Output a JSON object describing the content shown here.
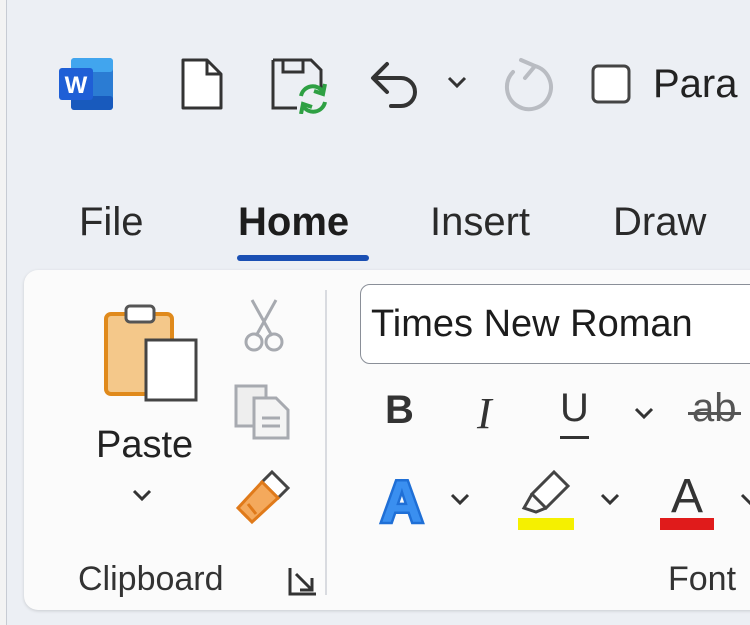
{
  "qat": {
    "document_title_partial": "Para K",
    "icons": [
      "word-logo-icon",
      "new-document-icon",
      "save-sync-icon",
      "undo-icon",
      "chevron-down-icon",
      "redo-icon",
      "checkbox-icon"
    ]
  },
  "tabs": [
    {
      "label": "File"
    },
    {
      "label": "Home",
      "active": true
    },
    {
      "label": "Insert"
    },
    {
      "label": "Draw"
    }
  ],
  "clipboard": {
    "paste_label": "Paste",
    "group_label": "Clipboard"
  },
  "font": {
    "font_name": "Times New Roman",
    "bold": "B",
    "italic": "I",
    "underline": "U",
    "strikethrough": "ab",
    "text_effect_letter": "A",
    "font_color_letter": "A",
    "group_label": "Font",
    "highlight_color": "#f5f000",
    "font_color": "#e01b1b"
  },
  "colors": {
    "accent": "#1a4fb3",
    "word_blue": "#1f5fd6"
  }
}
